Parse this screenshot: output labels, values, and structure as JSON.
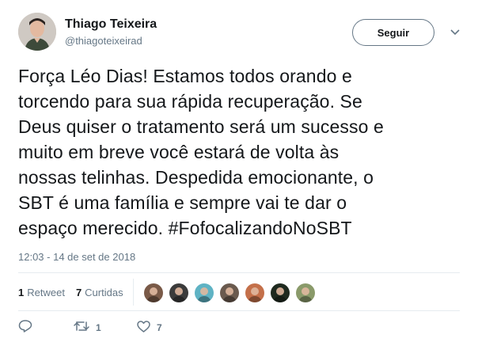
{
  "author": {
    "name": "Thiago Teixeira",
    "handle": "@thiagoteixeirad"
  },
  "follow_button_label": "Seguir",
  "tweet": {
    "text_before_hashtag": "Força Léo Dias! Estamos todos orando e\ntorcendo para sua rápida recuperação. Se\nDeus quiser o tratamento será um sucesso e\nmuito em breve você estará de volta às\nnossas telinhas. Despedida emocionante, o\nSBT é uma família e sempre vai te dar o\nespaço merecido. ",
    "hashtag": "#FofocalizandoNoSBT",
    "timestamp": "12:03 - 14 de set de 2018"
  },
  "stats": {
    "retweets_count": "1",
    "retweets_label": "Retweet",
    "likes_count": "7",
    "likes_label": "Curtidas"
  },
  "liker_avatars": [
    {
      "color": "#7a5a48"
    },
    {
      "color": "#3b3b3b"
    },
    {
      "color": "#5fb3c4"
    },
    {
      "color": "#6a5a4e"
    },
    {
      "color": "#c4704a"
    },
    {
      "color": "#1f2a1f"
    },
    {
      "color": "#8a9a6a"
    }
  ],
  "actions": {
    "reply_icon": "reply-icon",
    "retweet_count": "1",
    "like_count": "7"
  },
  "colors": {
    "text_primary": "#14171a",
    "text_secondary": "#657786",
    "divider": "#e6ecf0"
  }
}
